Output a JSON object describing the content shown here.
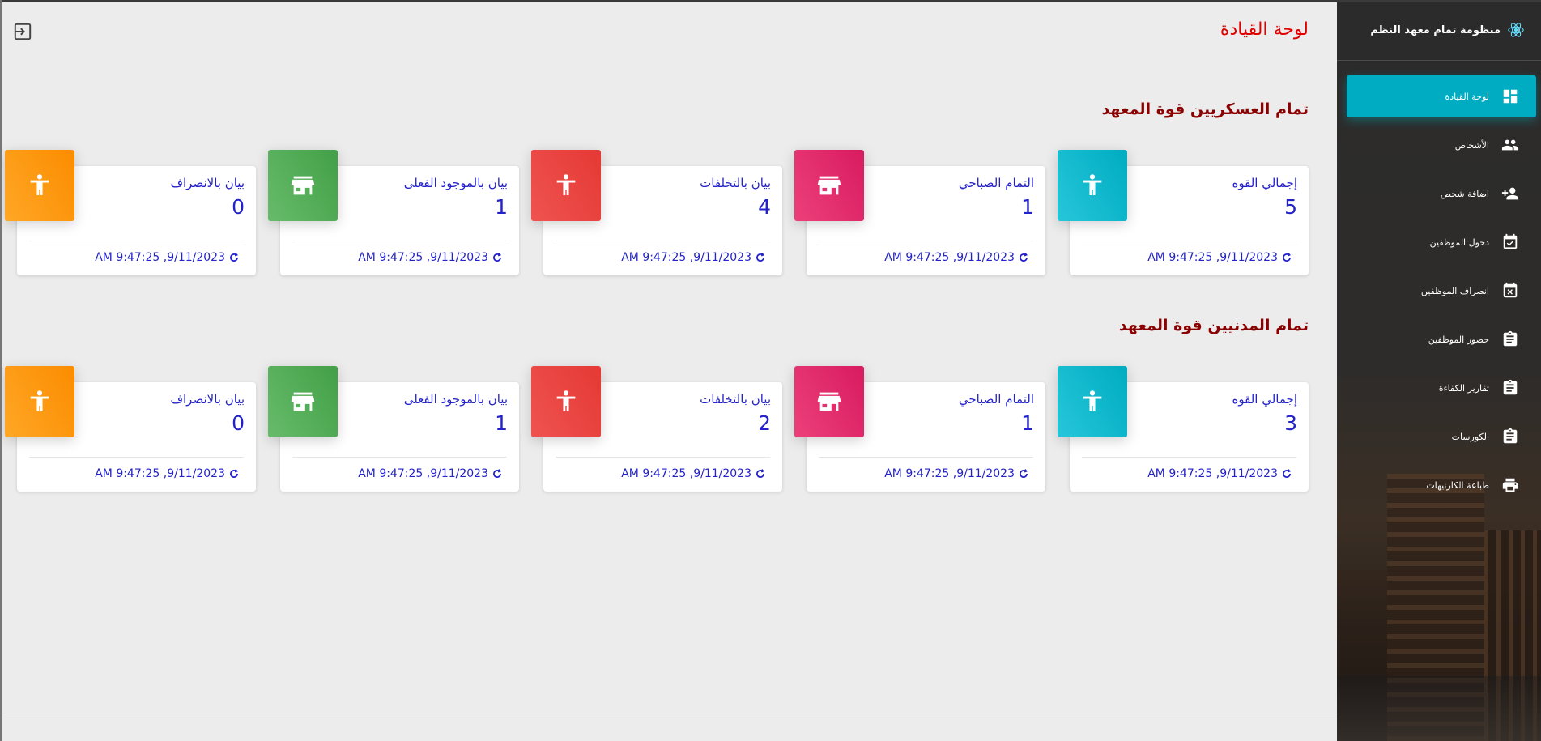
{
  "app": {
    "title": "منظومة تمام معهد النظم"
  },
  "sidebar": {
    "items": [
      {
        "label": "لوحة القيادة",
        "icon": "dashboard-icon",
        "active": true
      },
      {
        "label": "الأشخاص",
        "icon": "people-icon"
      },
      {
        "label": "اضافة شخص",
        "icon": "add-person-icon"
      },
      {
        "label": "دخول الموظفين",
        "icon": "calendar-check-icon"
      },
      {
        "label": "انصراف الموظفين",
        "icon": "calendar-x-icon"
      },
      {
        "label": "حضور الموظفين",
        "icon": "clipboard-icon"
      },
      {
        "label": "تقارير الكفاءة",
        "icon": "clipboard-icon"
      },
      {
        "label": "الكورسات",
        "icon": "clipboard-icon"
      },
      {
        "label": "طباعة الكارنيهات",
        "icon": "printer-icon"
      }
    ]
  },
  "header": {
    "page_title": "لوحة القيادة"
  },
  "sections": [
    {
      "title": "تمام العسكريين قوة المعهد",
      "cards": [
        {
          "title": "إجمالي القوه",
          "value": "5",
          "timestamp": "9/11/2023, 9:47:25 AM",
          "icon": "person-icon",
          "color": "#00acc1"
        },
        {
          "title": "التمام الصباحي",
          "value": "1",
          "timestamp": "9/11/2023, 9:47:25 AM",
          "icon": "store-icon",
          "color": "#e91e63"
        },
        {
          "title": "بيان بالتخلفات",
          "value": "4",
          "timestamp": "9/11/2023, 9:47:25 AM",
          "icon": "person-icon",
          "color": "#e53935"
        },
        {
          "title": "بيان بالموجود الفعلى",
          "value": "1",
          "timestamp": "9/11/2023, 9:47:25 AM",
          "icon": "store-icon",
          "color": "#43a047"
        },
        {
          "title": "بيان بالانصراف",
          "value": "0",
          "timestamp": "9/11/2023, 9:47:25 AM",
          "icon": "person-icon",
          "color": "#fb8c00"
        }
      ]
    },
    {
      "title": "تمام المدنيين قوة المعهد",
      "cards": [
        {
          "title": "إجمالي القوه",
          "value": "3",
          "timestamp": "9/11/2023, 9:47:25 AM",
          "icon": "person-icon",
          "color": "#00acc1"
        },
        {
          "title": "التمام الصباحي",
          "value": "1",
          "timestamp": "9/11/2023, 9:47:25 AM",
          "icon": "store-icon",
          "color": "#e91e63"
        },
        {
          "title": "بيان بالتخلفات",
          "value": "2",
          "timestamp": "9/11/2023, 9:47:25 AM",
          "icon": "person-icon",
          "color": "#e53935"
        },
        {
          "title": "بيان بالموجود الفعلى",
          "value": "1",
          "timestamp": "9/11/2023, 9:47:25 AM",
          "icon": "store-icon",
          "color": "#43a047"
        },
        {
          "title": "بيان بالانصراف",
          "value": "0",
          "timestamp": "9/11/2023, 9:47:25 AM",
          "icon": "person-icon",
          "color": "#fb8c00"
        }
      ]
    }
  ]
}
